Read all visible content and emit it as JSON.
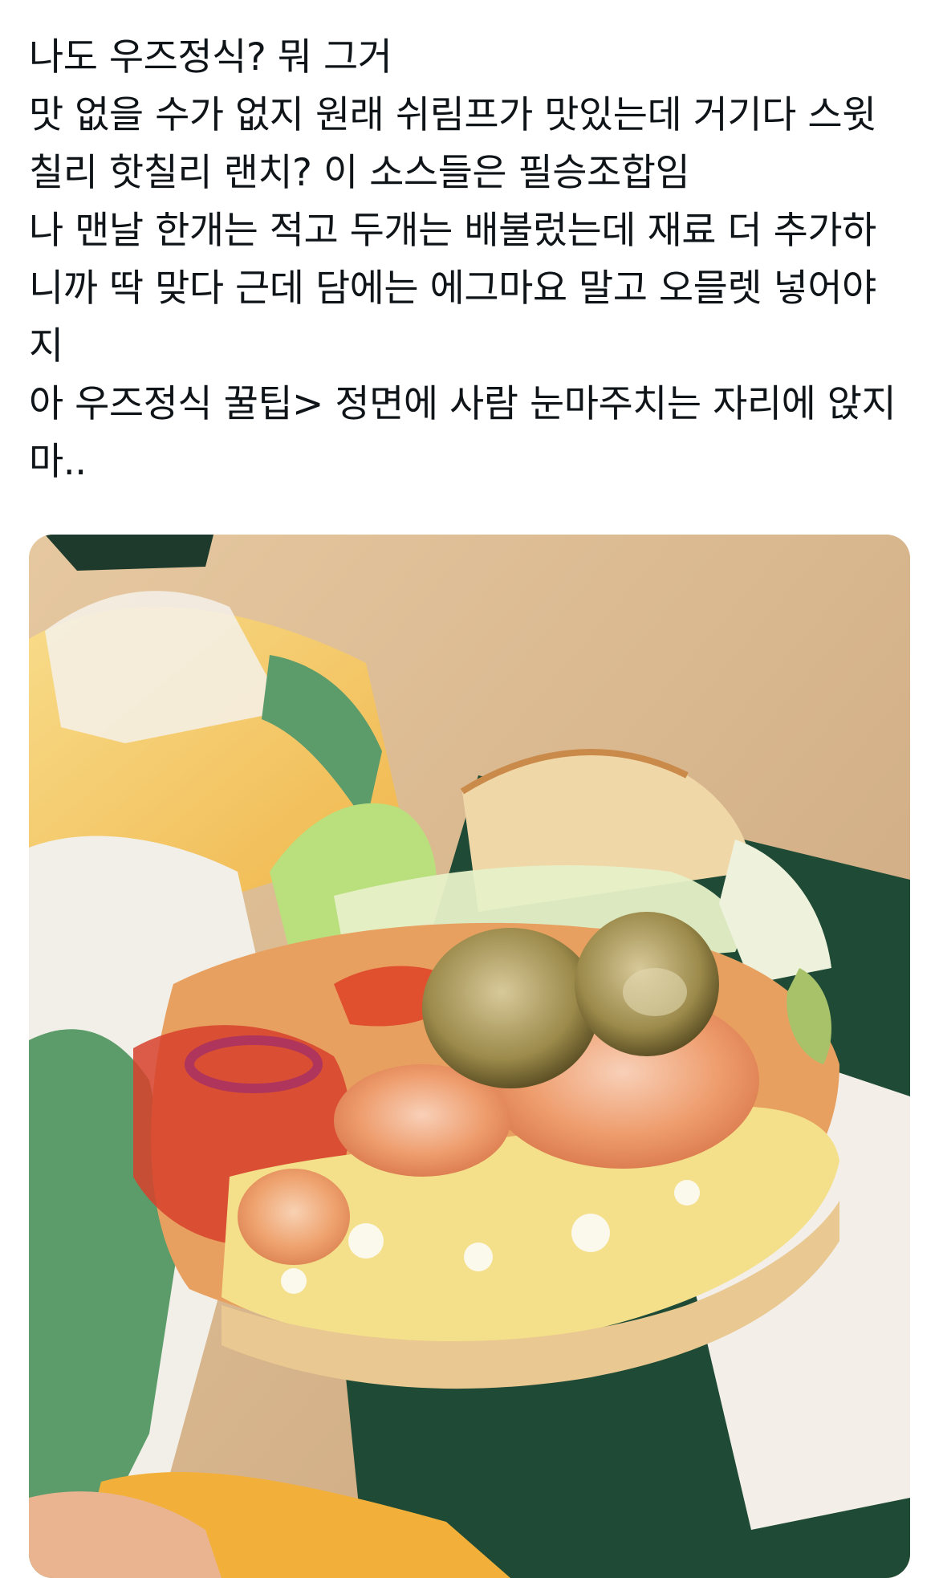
{
  "tweet": {
    "lines": [
      "나도 우즈정식? 뭐 그거",
      "맛 없을 수가 없지 원래 쉬림프가 맛있는데 거기다 스윗",
      "칠리 핫칠리 랜치? 이 소스들은 필승조합임",
      "나 맨날 한개는 적고 두개는 배불렀는데 재료 더 추가하",
      "니까 딱 맞다 근데 담에는 에그마요 말고 오믈렛 넣어야",
      "지",
      "아 우즈정식 꿀팁> 정면에 사람 눈마주치는 자리에 앉지",
      "마.."
    ]
  },
  "media": {
    "description_icon": "photo-sandwich-image",
    "colors": {
      "table": "#d9b98e",
      "tray": "#1f4a35",
      "wrapper_yellow": "#f3c44a",
      "wrapper_green": "#5c9b6a",
      "bread": "#f0d7a8",
      "lettuce": "#b9e07c",
      "egg_mayo": "#f4e08a",
      "shrimp": "#ee9c6c",
      "pickle": "#8a7a3a",
      "sauce": "#d7412b"
    }
  }
}
